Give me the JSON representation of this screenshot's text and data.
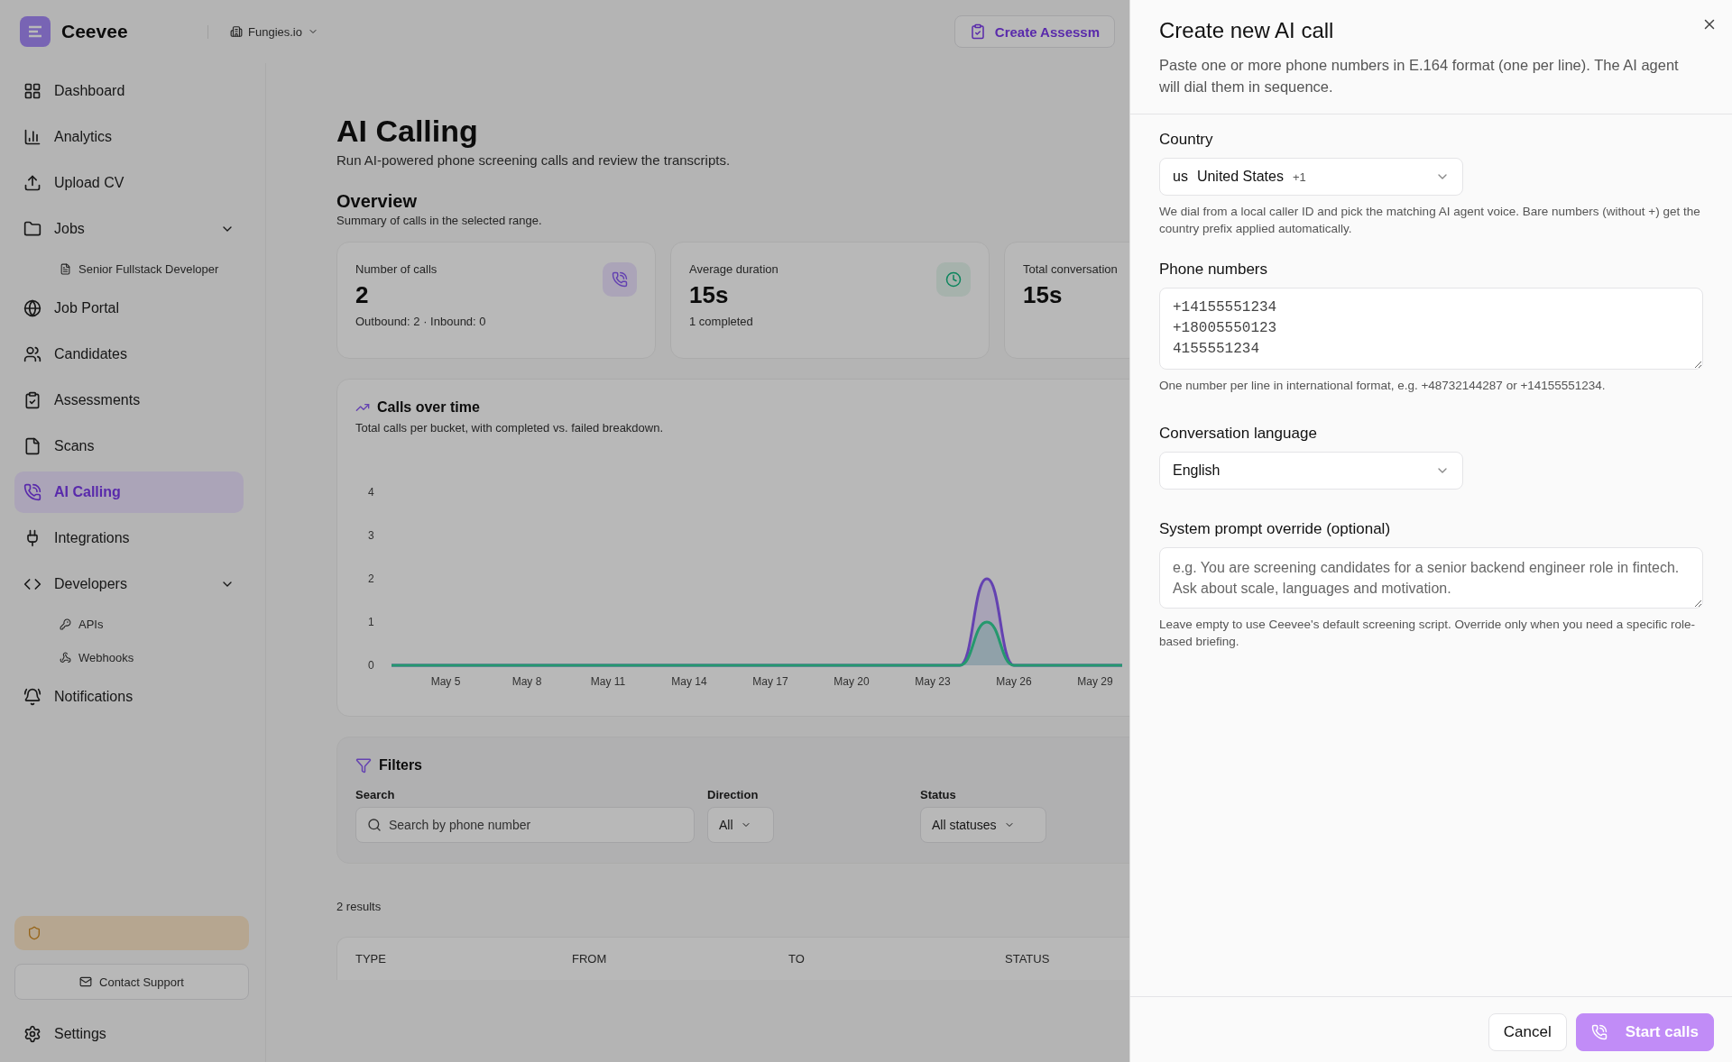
{
  "app": {
    "brand": "Ceevee",
    "workspace": "Fungies.io",
    "top_action": "Create Assessm"
  },
  "sidebar": {
    "items": [
      {
        "kind": "item",
        "label": "Dashboard",
        "selected": false
      },
      {
        "kind": "item",
        "label": "Analytics",
        "selected": false
      },
      {
        "kind": "item",
        "label": "Upload CV",
        "selected": false
      },
      {
        "kind": "item",
        "label": "Jobs",
        "selected": false,
        "expanded": true,
        "children": [
          {
            "label": "Senior Fullstack Developer",
            "selected": false
          }
        ]
      },
      {
        "kind": "item",
        "label": "Job Portal",
        "selected": false
      },
      {
        "kind": "item",
        "label": "Candidates",
        "selected": false
      },
      {
        "kind": "item",
        "label": "Assessments",
        "selected": false
      },
      {
        "kind": "item",
        "label": "Scans",
        "selected": false
      },
      {
        "kind": "item",
        "label": "AI Calling",
        "selected": true
      },
      {
        "kind": "item",
        "label": "Integrations",
        "selected": false
      },
      {
        "kind": "item",
        "label": "Developers",
        "selected": false,
        "expanded": true,
        "children": [
          {
            "label": "APIs",
            "selected": false
          },
          {
            "label": "Webhooks",
            "selected": false
          }
        ]
      },
      {
        "kind": "item",
        "label": "Notifications",
        "selected": false
      }
    ],
    "contact": "Contact Support",
    "settings": "Settings"
  },
  "page": {
    "title": "AI Calling",
    "subtitle": "Run AI-powered phone screening calls and review the transcripts.",
    "overview": {
      "title": "Overview",
      "subtitle": "Summary of calls in the selected range.",
      "cards": [
        {
          "label": "Number of calls",
          "value": "2",
          "note": "Outbound: 2 · Inbound: 0"
        },
        {
          "label": "Average duration",
          "value": "15s",
          "note": "1 completed"
        },
        {
          "label": "Total conversation",
          "value": "15s"
        }
      ]
    },
    "chart": {
      "title": "Calls over time",
      "subtitle": "Total calls per bucket, with completed vs. failed breakdown.",
      "chart_data": {
        "type": "area",
        "categories": [
          null,
          null,
          "May 5",
          null,
          null,
          "May 8",
          null,
          null,
          "May 11",
          null,
          null,
          "May 14",
          null,
          null,
          "May 17",
          null,
          null,
          "May 20",
          null,
          null,
          "May 23",
          null,
          null,
          "May 26",
          null,
          null,
          "May 29",
          null
        ],
        "series": [
          {
            "color": "#8b5cf6",
            "values": [
              0,
              0,
              0,
              0,
              0,
              0,
              0,
              0,
              0,
              0,
              0,
              0,
              0,
              0,
              0,
              0,
              0,
              0,
              0,
              0,
              0,
              0,
              2,
              0,
              0,
              0,
              0,
              0
            ]
          },
          {
            "color": "#34d399",
            "values": [
              0,
              0,
              0,
              0,
              0,
              0,
              0,
              0,
              0,
              0,
              0,
              0,
              0,
              0,
              0,
              0,
              0,
              0,
              0,
              0,
              0,
              0,
              1,
              0,
              0,
              0,
              0,
              0
            ]
          }
        ],
        "ylim": [
          0,
          4
        ],
        "yticks": [
          0,
          1,
          2,
          3,
          4
        ]
      }
    },
    "filters": {
      "title": "Filters",
      "search_label": "Search",
      "search_placeholder": "Search by phone number",
      "direction_label": "Direction",
      "direction_value": "All",
      "status_label": "Status",
      "status_value": "All statuses"
    },
    "results": "2 results",
    "table": {
      "columns": [
        "TYPE",
        "FROM",
        "TO",
        "STATUS"
      ]
    }
  },
  "dialog": {
    "title": "Create new AI call",
    "description": "Paste one or more phone numbers in E.164 format (one per line). The AI agent will dial them in sequence.",
    "country": {
      "label": "Country",
      "code": "us",
      "name": "United States",
      "prefix": "+1",
      "help": "We dial from a local caller ID and pick the matching AI agent voice. Bare numbers (without +) get the country prefix applied automatically."
    },
    "phones": {
      "label": "Phone numbers",
      "value": "+14155551234\n+18005550123\n4155551234",
      "help": "One number per line in international format, e.g. +48732144287 or +14155551234."
    },
    "language": {
      "label": "Conversation language",
      "value": "English"
    },
    "prompt": {
      "label": "System prompt override (optional)",
      "placeholder": "e.g. You are screening candidates for a senior backend engineer role in fintech. Ask about scale, languages and motivation.",
      "help": "Leave empty to use Ceevee's default screening script. Override only when you need a specific role-based briefing."
    },
    "buttons": {
      "cancel": "Cancel",
      "submit": "Start calls"
    }
  }
}
